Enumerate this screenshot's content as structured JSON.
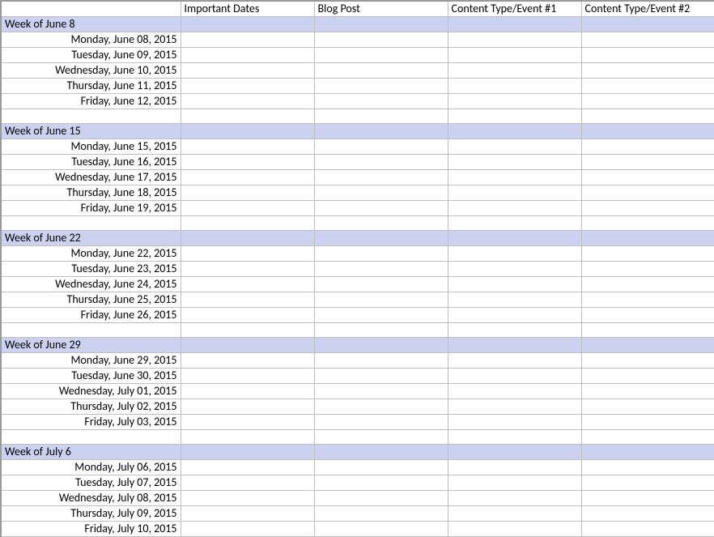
{
  "headers": {
    "col0": "",
    "col1": "Important Dates",
    "col2": "Blog Post",
    "col3": "Content Type/Event #1",
    "col4": "Content Type/Event #2"
  },
  "weeks": [
    {
      "label": "Week of June 8",
      "days": [
        "Monday, June 08, 2015",
        "Tuesday, June 09, 2015",
        "Wednesday, June 10, 2015",
        "Thursday, June 11, 2015",
        "Friday, June 12, 2015"
      ]
    },
    {
      "label": "Week of June 15",
      "days": [
        "Monday, June 15, 2015",
        "Tuesday, June 16, 2015",
        "Wednesday, June 17, 2015",
        "Thursday, June 18, 2015",
        "Friday, June 19, 2015"
      ]
    },
    {
      "label": "Week of June 22",
      "days": [
        "Monday, June 22, 2015",
        "Tuesday, June 23, 2015",
        "Wednesday, June 24, 2015",
        "Thursday, June 25, 2015",
        "Friday, June 26, 2015"
      ]
    },
    {
      "label": "Week of June 29",
      "days": [
        "Monday, June 29, 2015",
        "Tuesday, June 30, 2015",
        "Wednesday, July 01, 2015",
        "Thursday, July 02, 2015",
        "Friday, July 03, 2015"
      ]
    },
    {
      "label": "Week of July 6",
      "days": [
        "Monday, July 06, 2015",
        "Tuesday, July 07, 2015",
        "Wednesday, July 08, 2015",
        "Thursday, July 09, 2015",
        "Friday, July 10, 2015"
      ]
    }
  ]
}
